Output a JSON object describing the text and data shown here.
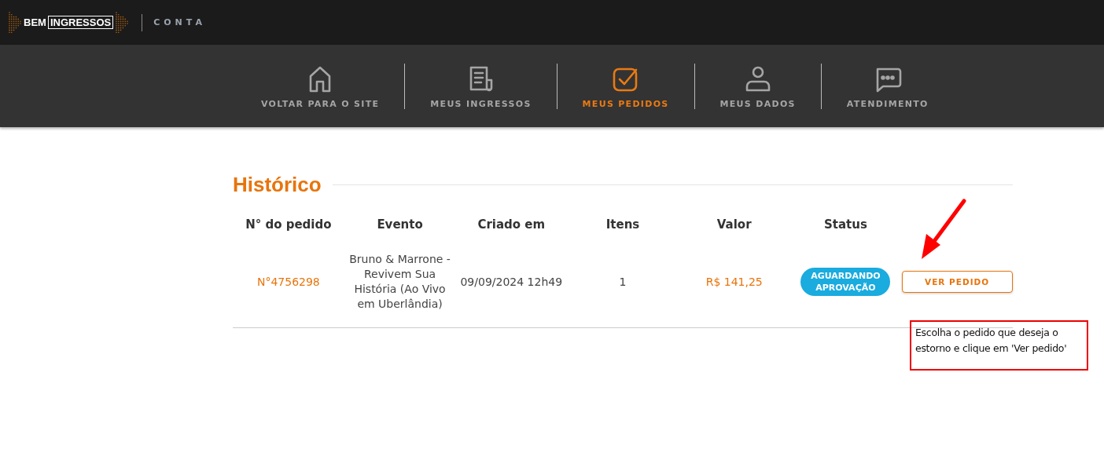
{
  "header": {
    "logo": {
      "left": "BEM",
      "boxed": "INGRESSOS"
    },
    "section": "CONTA"
  },
  "nav": [
    {
      "label": "VOLTAR PARA O SITE",
      "kind": "house",
      "selected": false
    },
    {
      "label": "MEUS INGRESSOS",
      "kind": "receipt",
      "selected": false
    },
    {
      "label": "MEUS PEDIDOS",
      "kind": "check",
      "selected": true
    },
    {
      "label": "MEUS DADOS",
      "kind": "person",
      "selected": false
    },
    {
      "label": "ATENDIMENTO",
      "kind": "chat",
      "selected": false
    }
  ],
  "history": {
    "title": "Histórico",
    "columns": [
      "N° do pedido",
      "Evento",
      "Criado em",
      "Itens",
      "Valor",
      "Status"
    ],
    "rows": [
      {
        "order": "N°4756298",
        "event": "Bruno & Marrone - Revivem Sua História (Ao Vivo em Uberlândia)",
        "created": "09/09/2024 12h49",
        "items": "1",
        "value": "R$ 141,25",
        "status": "AGUARDANDO APROVAÇÃO",
        "action": "VER PEDIDO"
      }
    ]
  },
  "annotation": {
    "text": "Escolha o pedido que deseja o estorno e clique em 'Ver pedido'"
  }
}
